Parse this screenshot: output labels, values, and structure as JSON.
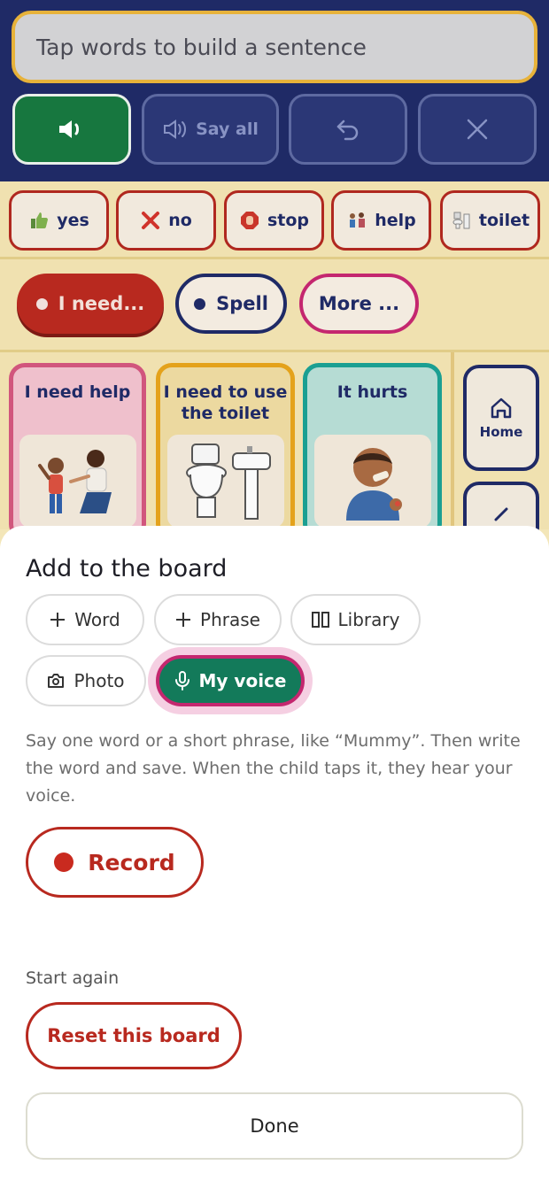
{
  "sentence_bar": {
    "placeholder": "Tap words to build a sentence"
  },
  "controls": {
    "speak_icon": "speaker-icon",
    "say_all_label": "Say all",
    "undo_icon": "undo-icon",
    "clear_icon": "close-icon"
  },
  "quick_words": [
    {
      "label": "yes",
      "icon": "thumbs-up-icon"
    },
    {
      "label": "no",
      "icon": "cross-icon"
    },
    {
      "label": "stop",
      "icon": "stop-hand-icon"
    },
    {
      "label": "help",
      "icon": "help-icon"
    },
    {
      "label": "toilet",
      "icon": "toilet-icon"
    }
  ],
  "modes": {
    "need_label": "I need...",
    "spell_label": "Spell",
    "more_label": "More ..."
  },
  "cards": [
    {
      "label": "I need help"
    },
    {
      "label": "I need to use the toilet"
    },
    {
      "label": "It hurts"
    }
  ],
  "nav": {
    "home_label": "Home"
  },
  "sheet": {
    "title": "Add to the board",
    "options": {
      "word": "Word",
      "phrase": "Phrase",
      "library": "Library",
      "photo": "Photo",
      "voice": "My voice"
    },
    "help_text": "Say one word or a short phrase, like “Mummy”. Then write the word and save. When the child taps it, they hear your voice.",
    "record_label": "Record",
    "start_again_label": "Start again",
    "reset_label": "Reset this board",
    "done_label": "Done"
  },
  "colors": {
    "navy": "#1f2a66",
    "speak_green": "#17773f",
    "voice_green": "#137a5a",
    "accent_red": "#b8291f",
    "accent_pink": "#c4276f",
    "board_yellow": "#f0e1b0"
  }
}
